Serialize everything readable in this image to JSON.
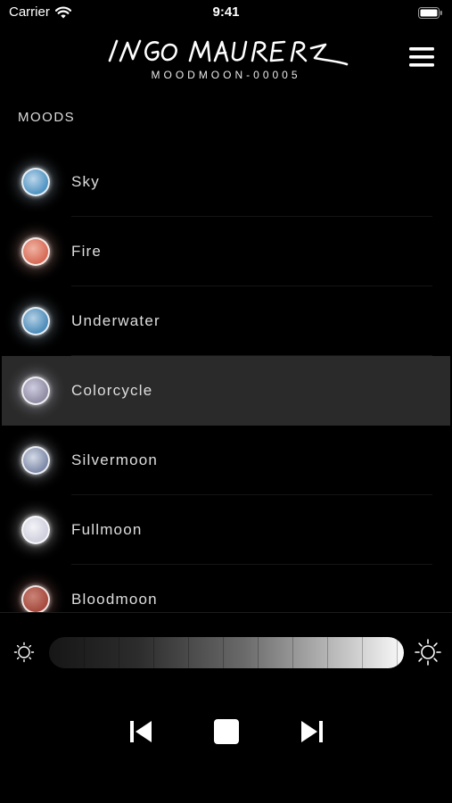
{
  "status_bar": {
    "carrier": "Carrier",
    "time": "9:41"
  },
  "header": {
    "brand": "Ingo Maurer",
    "serial": "MOODMOON-00005",
    "menu_icon": "hamburger-menu-icon"
  },
  "section_title": "MOODS",
  "moods": [
    {
      "label": "Sky",
      "color": "#4f93c2",
      "glow": "#bcd6ea",
      "selected": false
    },
    {
      "label": "Fire",
      "color": "#d66a55",
      "glow": "#f0b3a3",
      "selected": false
    },
    {
      "label": "Underwater",
      "color": "#4c8cba",
      "glow": "#b4d0e4",
      "selected": false
    },
    {
      "label": "Colorcycle",
      "color": "#8f8ca3",
      "glow": "#cfcde0",
      "selected": true
    },
    {
      "label": "Silvermoon",
      "color": "#7d89a8",
      "glow": "#d4dae6",
      "selected": false
    },
    {
      "label": "Fullmoon",
      "color": "#cfcfde",
      "glow": "#f3f3f7",
      "selected": false
    },
    {
      "label": "Bloodmoon",
      "color": "#a64a3e",
      "glow": "#c98477",
      "selected": false
    }
  ],
  "brightness": {
    "level_percent": 100,
    "min_icon": "sun-small-icon",
    "max_icon": "sun-large-icon"
  },
  "player": {
    "prev_icon": "skip-back-icon",
    "stop_icon": "stop-icon",
    "next_icon": "skip-forward-icon"
  }
}
